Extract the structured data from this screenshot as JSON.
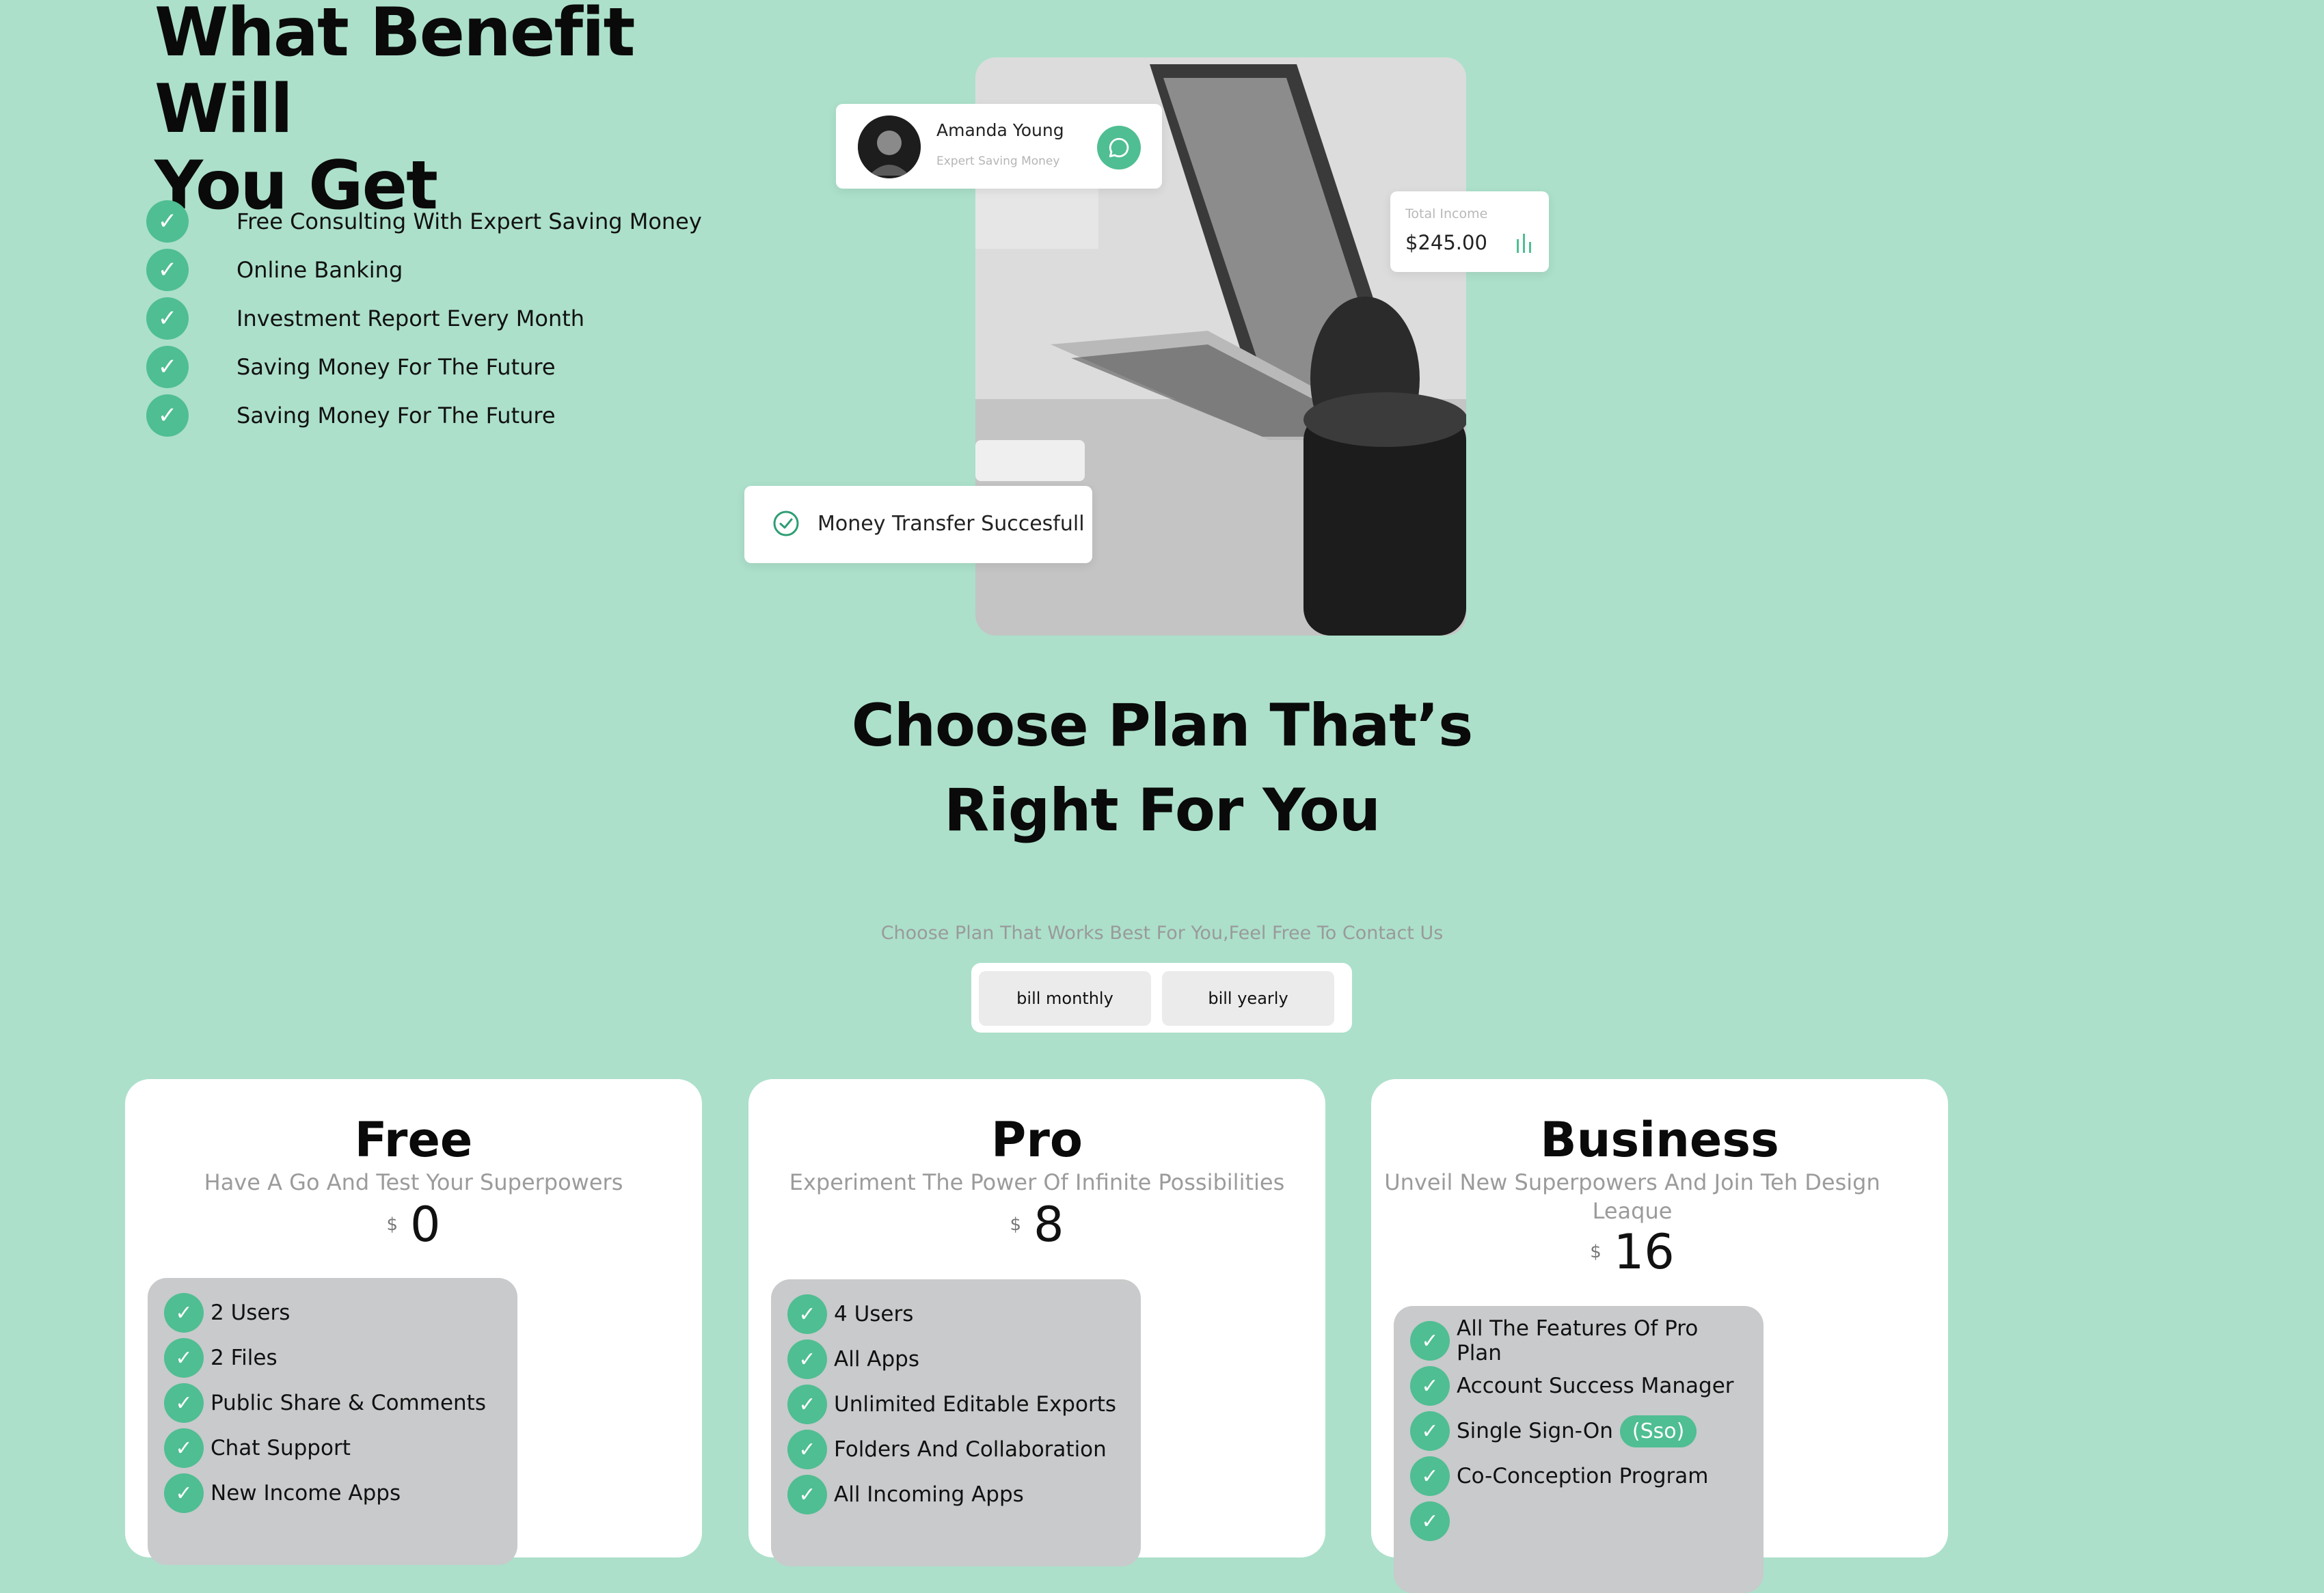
{
  "benefits": {
    "title_line1": "What Benefit Will",
    "title_line2": "You Get",
    "items": [
      "Free Consulting With Expert Saving Money",
      "Online Banking",
      "Investment Report Every Month",
      "Saving Money For The Future",
      "Saving Money For The Future"
    ]
  },
  "profile_card": {
    "name": "Amanda Young",
    "role": "Expert Saving Money"
  },
  "income_card": {
    "label": "Total Income",
    "value": "$245.00"
  },
  "transfer_card": {
    "text": "Money Transfer Succesfull"
  },
  "plans_section": {
    "title_line1": "Choose Plan That’s",
    "title_line2": "Right For You",
    "subtitle": "Choose Plan That Works Best For You,Feel Free To Contact Us",
    "toggle": {
      "monthly": "bill monthly",
      "yearly": "bill yearly"
    }
  },
  "plans": [
    {
      "name": "Free",
      "description": "Have A Go And Test Your Superpowers",
      "currency": "$",
      "price": "0",
      "features": [
        "2 Users",
        "2 Files",
        "Public Share & Comments",
        "Chat Support",
        "New Income Apps"
      ]
    },
    {
      "name": "Pro",
      "description": "Experiment The Power Of Infinite Possibilities",
      "currency": "$",
      "price": "8",
      "features": [
        "4 Users",
        "All Apps",
        "Unlimited Editable Exports",
        "Folders And Collaboration",
        "All Incoming Apps"
      ]
    },
    {
      "name": "Business",
      "description": "Unveil New Superpowers And Join Teh Design Leaque",
      "currency": "$",
      "price": "16",
      "features": [
        "All The Features Of Pro Plan",
        "Account Success Manager",
        "Single Sign-On",
        "Co-Conception Program"
      ],
      "sso_tag": "(Sso)"
    }
  ],
  "colors": {
    "background": "#ace0cb",
    "accent": "#4fbe92",
    "feature_box": "#c8cacc"
  },
  "icons": {
    "check": "check-icon",
    "chat": "chat-icon",
    "chart": "bar-chart-icon",
    "success": "check-circle-icon"
  }
}
